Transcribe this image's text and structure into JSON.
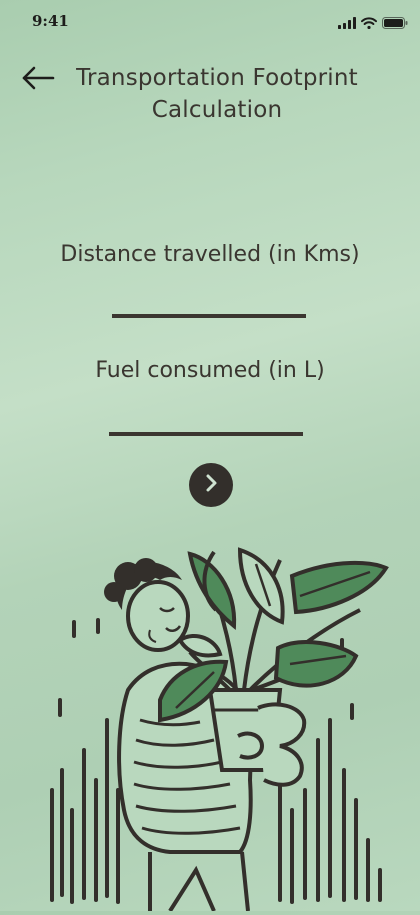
{
  "status_bar": {
    "time": "9:41"
  },
  "header": {
    "title": "Transportation Footprint Calculation"
  },
  "form": {
    "distance_label": "Distance travelled (in Kms)",
    "distance_value": "",
    "fuel_label": "Fuel consumed (in L)",
    "fuel_value": ""
  },
  "icons": {
    "back": "arrow-left-icon",
    "next": "chevron-right-icon",
    "signal": "signal-icon",
    "wifi": "wifi-icon",
    "battery": "battery-icon"
  },
  "colors": {
    "background": "#b7d7bc",
    "ink": "#332f2b",
    "leaf": "#4f8a5a"
  }
}
